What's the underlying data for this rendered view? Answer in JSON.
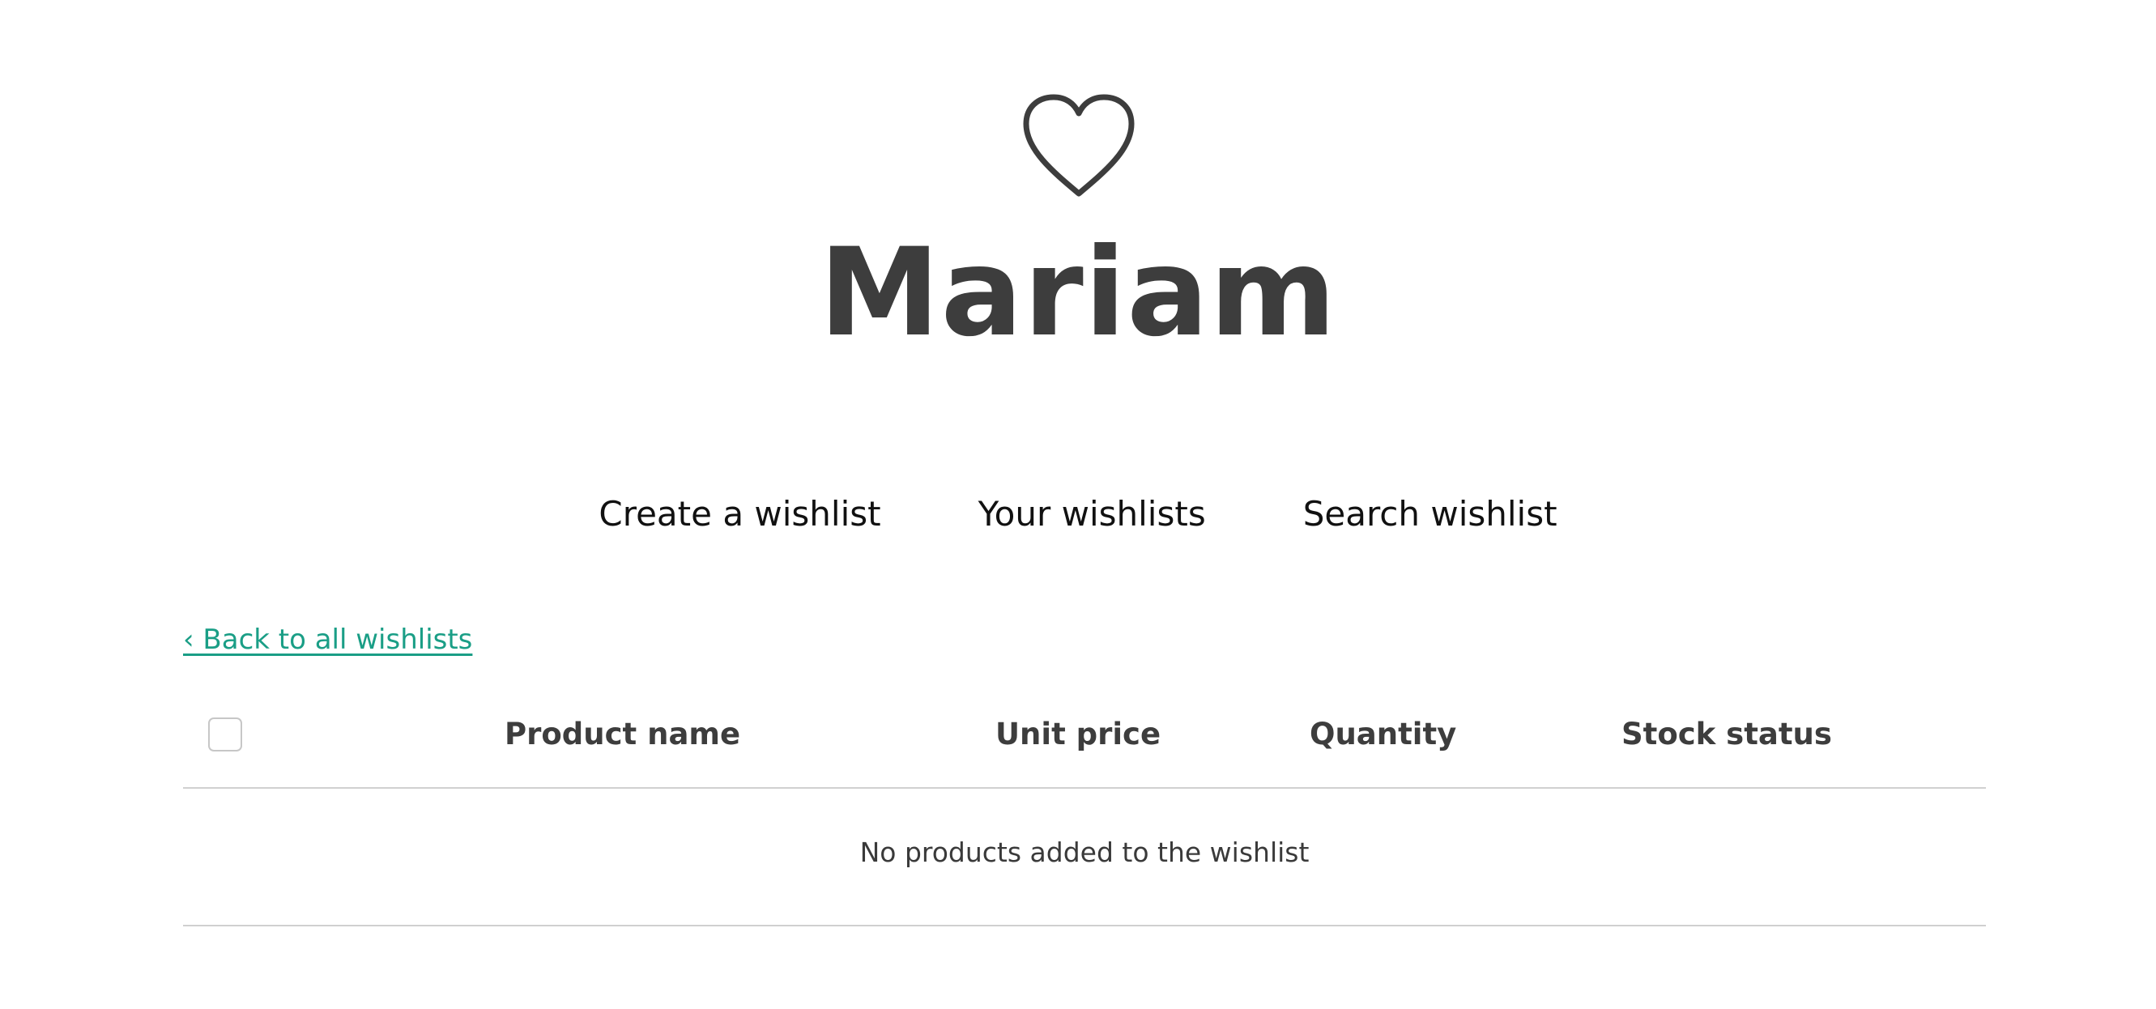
{
  "wishlist": {
    "title": "Mariam"
  },
  "icons": {
    "header_icon": "heart-icon"
  },
  "nav": {
    "items": [
      {
        "label": "Create a wishlist"
      },
      {
        "label": "Your wishlists"
      },
      {
        "label": "Search wishlist"
      }
    ]
  },
  "back_link": {
    "label": "‹ Back to all wishlists"
  },
  "table": {
    "columns": [
      "Product name",
      "Unit price",
      "Quantity",
      "Stock status"
    ],
    "select_all_checked": false,
    "empty_message": "No products added to the wishlist"
  },
  "colors": {
    "text": "#3d3d3d",
    "link": "#1a9e86",
    "divider": "#d0d0d0"
  }
}
